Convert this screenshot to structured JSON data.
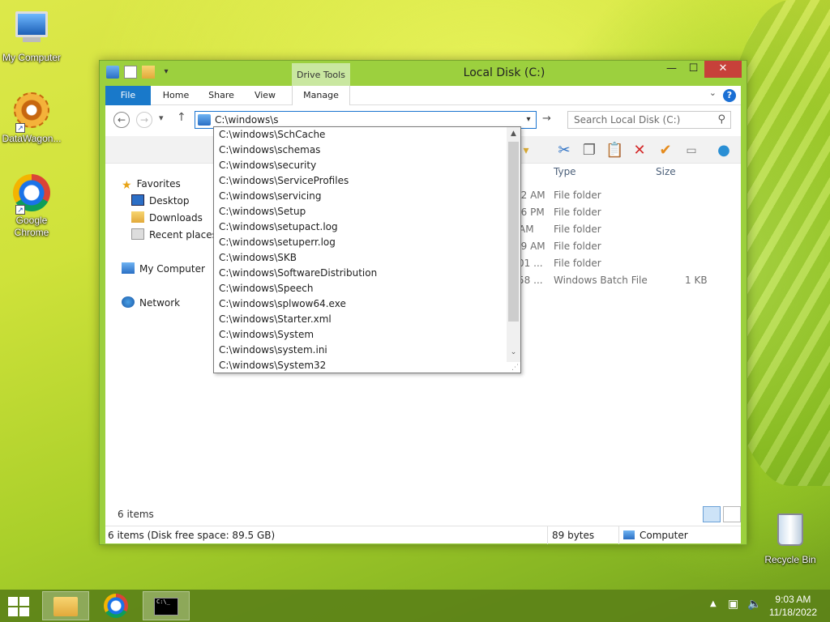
{
  "desktop": {
    "icons": [
      {
        "label": "My Computer"
      },
      {
        "label": "DataWagon..."
      },
      {
        "label": "Google Chrome"
      },
      {
        "label": "Recycle Bin"
      }
    ]
  },
  "window": {
    "title": "Local Disk (C:)",
    "context_tab": "Drive Tools",
    "tabs": [
      {
        "label": "File"
      },
      {
        "label": "Home"
      },
      {
        "label": "Share"
      },
      {
        "label": "View"
      },
      {
        "label": "Manage"
      }
    ],
    "address_value": "C:\\windows\\s",
    "search_placeholder": "Search Local Disk (C:)",
    "autocomplete": [
      "C:\\windows\\SchCache",
      "C:\\windows\\schemas",
      "C:\\windows\\security",
      "C:\\windows\\ServiceProfiles",
      "C:\\windows\\servicing",
      "C:\\windows\\Setup",
      "C:\\windows\\setupact.log",
      "C:\\windows\\setuperr.log",
      "C:\\windows\\SKB",
      "C:\\windows\\SoftwareDistribution",
      "C:\\windows\\Speech",
      "C:\\windows\\splwow64.exe",
      "C:\\windows\\Starter.xml",
      "C:\\windows\\System",
      "C:\\windows\\system.ini",
      "C:\\windows\\System32"
    ],
    "nav": {
      "favorites": "Favorites",
      "desktop": "Desktop",
      "downloads": "Downloads",
      "recent": "Recent places",
      "computer": "My Computer",
      "network": "Network"
    },
    "columns": {
      "type": "Type",
      "size": "Size"
    },
    "rows": [
      {
        "date_tail": "22 AM",
        "type": "File folder",
        "size": ""
      },
      {
        "date_tail": "46 PM",
        "type": "File folder",
        "size": ""
      },
      {
        "date_tail": "AM",
        "type": "File folder",
        "size": ""
      },
      {
        "date_tail": "39 AM",
        "type": "File folder",
        "size": ""
      },
      {
        "date_tail": ":01 ...",
        "type": "File folder",
        "size": ""
      },
      {
        "date_tail": ":58 ...",
        "type": "Windows Batch File",
        "size": "1 KB"
      }
    ],
    "item_count": "6 items",
    "status": {
      "left": "6 items (Disk free space: 89.5 GB)",
      "middle": "89 bytes",
      "right": "Computer"
    }
  },
  "taskbar": {
    "time": "9:03 AM",
    "date": "11/18/2022"
  }
}
